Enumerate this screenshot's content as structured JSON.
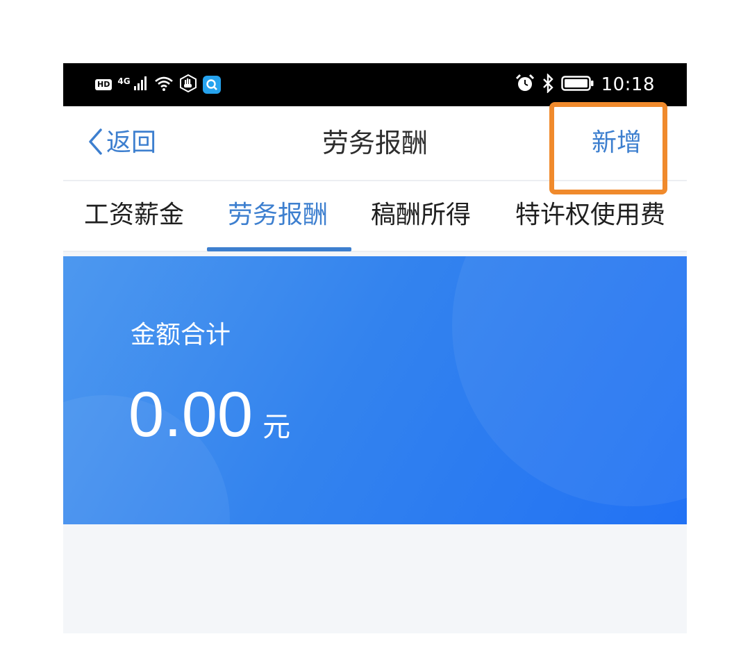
{
  "status_bar": {
    "left_badges": [
      "HD",
      "4G"
    ],
    "time": "10:18",
    "icons": [
      "signal-icon",
      "wifi-icon",
      "hand-shield-icon",
      "search-app-icon",
      "alarm-icon",
      "bluetooth-icon",
      "battery-icon"
    ]
  },
  "nav": {
    "back_label": "返回",
    "title": "劳务报酬",
    "add_label": "新增"
  },
  "tabs": [
    {
      "label": "工资薪金",
      "active": false
    },
    {
      "label": "劳务报酬",
      "active": true
    },
    {
      "label": "稿酬所得",
      "active": false
    },
    {
      "label": "特许权使用费",
      "active": false
    }
  ],
  "summary": {
    "label": "金额合计",
    "amount": "0.00",
    "unit": "元"
  },
  "colors": {
    "accent": "#3d7fcf",
    "highlight": "#f08a2c",
    "card_start": "#4d98ef",
    "card_end": "#2272f4"
  }
}
